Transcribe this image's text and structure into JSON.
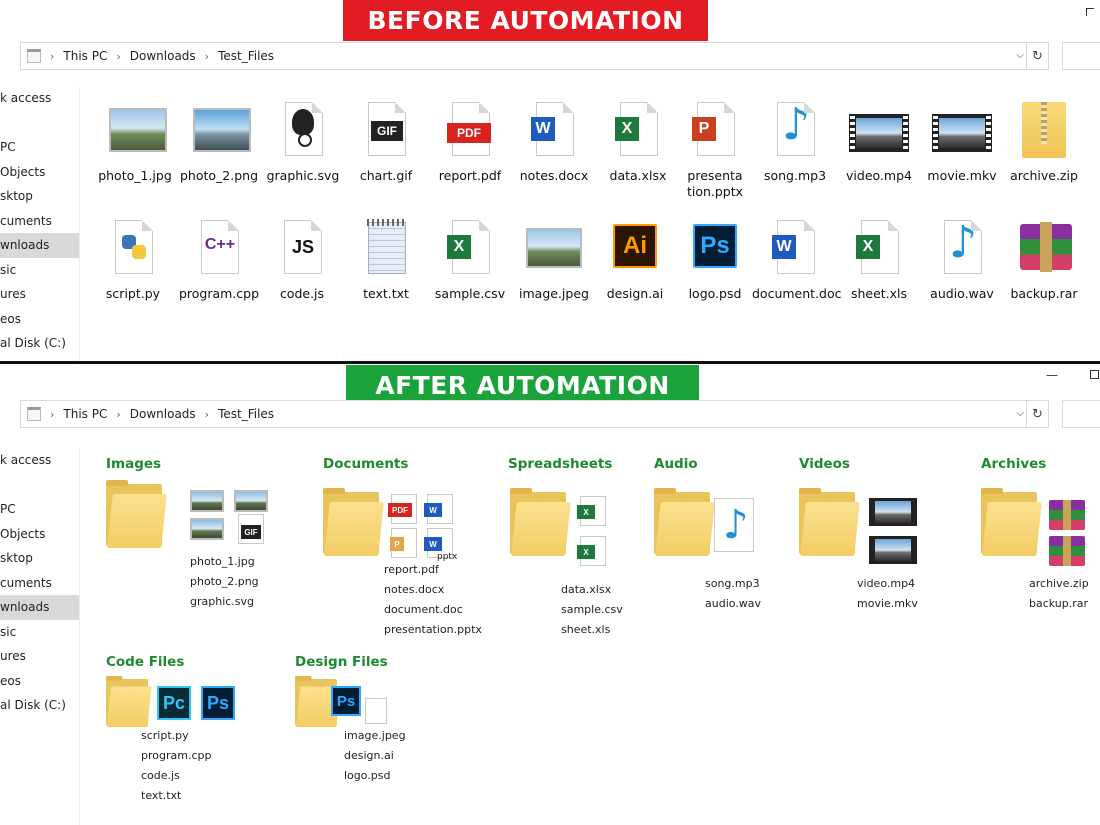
{
  "before": {
    "banner": "BEFORE AUTOMATION",
    "breadcrumb": [
      "This PC",
      "Downloads",
      "Test_Files"
    ],
    "nav": [
      "k access",
      "",
      "PC",
      "Objects",
      "sktop",
      "cuments",
      "wnloads",
      "sic",
      "ures",
      "eos",
      "al Disk (C:)"
    ],
    "files": [
      {
        "name": "photo_1.jpg",
        "icon": "image-icon"
      },
      {
        "name": "photo_2.png",
        "icon": "image-icon"
      },
      {
        "name": "graphic.svg",
        "icon": "inkscape-icon"
      },
      {
        "name": "chart.gif",
        "icon": "gif-icon"
      },
      {
        "name": "report.pdf",
        "icon": "pdf-icon"
      },
      {
        "name": "notes.docx",
        "icon": "word-icon"
      },
      {
        "name": "data.xlsx",
        "icon": "excel-icon"
      },
      {
        "name": "presentation.pptx",
        "icon": "powerpoint-icon"
      },
      {
        "name": "song.mp3",
        "icon": "audio-icon"
      },
      {
        "name": "video.mp4",
        "icon": "video-icon"
      },
      {
        "name": "movie.mkv",
        "icon": "video-icon"
      },
      {
        "name": "archive.zip",
        "icon": "zip-icon"
      },
      {
        "name": "script.py",
        "icon": "python-icon"
      },
      {
        "name": "program.cpp",
        "icon": "cpp-icon"
      },
      {
        "name": "code.js",
        "icon": "js-icon"
      },
      {
        "name": "text.txt",
        "icon": "notepad-icon"
      },
      {
        "name": "sample.csv",
        "icon": "excel-icon"
      },
      {
        "name": "image.jpeg",
        "icon": "image-icon"
      },
      {
        "name": "design.ai",
        "icon": "illustrator-icon"
      },
      {
        "name": "logo.psd",
        "icon": "photoshop-icon"
      },
      {
        "name": "document.doc",
        "icon": "word-icon"
      },
      {
        "name": "sheet.xls",
        "icon": "excel-icon"
      },
      {
        "name": "audio.wav",
        "icon": "audio-icon"
      },
      {
        "name": "backup.rar",
        "icon": "rar-icon"
      }
    ],
    "badges": {
      "gif": "GIF",
      "pdf": "PDF",
      "word": "W",
      "excel": "X",
      "ppt": "P",
      "cpp": "C++",
      "js": "JS",
      "ai": "Ai",
      "ps": "Ps"
    }
  },
  "after": {
    "banner": "AFTER AUTOMATION",
    "breadcrumb": [
      "This PC",
      "Downloads",
      "Test_Files"
    ],
    "nav": [
      "k access",
      "",
      "PC",
      "Objects",
      "sktop",
      "cuments",
      "wnloads",
      "sic",
      "ures",
      "eos",
      "al Disk (C:)"
    ],
    "groups": {
      "images": {
        "title": "Images",
        "files": [
          "photo_1.jpg",
          "photo_2.png",
          "graphic.svg"
        ]
      },
      "documents": {
        "title": "Documents",
        "files": [
          "report.pdf",
          "notes.docx",
          "document.doc",
          "presentation.pptx"
        ],
        "overlay": "pptx"
      },
      "spreadsheets": {
        "title": "Spreadsheets",
        "files": [
          "data.xlsx",
          "sample.csv",
          "sheet.xls"
        ]
      },
      "audio": {
        "title": "Audio",
        "files": [
          "song.mp3",
          "audio.wav"
        ]
      },
      "videos": {
        "title": "Videos",
        "files": [
          "video.mp4",
          "movie.mkv"
        ]
      },
      "archives": {
        "title": "Archives",
        "files": [
          "archive.zip",
          "backup.rar"
        ]
      },
      "code": {
        "title": "Code Files",
        "files": [
          "script.py",
          "program.cpp",
          "code.js",
          "text.txt"
        ]
      },
      "design": {
        "title": "Design Files",
        "files": [
          "image.jpeg",
          "design.ai",
          "logo.psd"
        ]
      }
    },
    "mini_badges": {
      "gif": "GIF",
      "pdf": "PDF",
      "word": "W",
      "excel": "X",
      "pc": "Pc",
      "ps": "Ps"
    }
  },
  "colors": {
    "before_banner": "#e31b23",
    "after_banner": "#1aa33a",
    "group_title": "#1e8a2f",
    "folder": "#f3cd64",
    "selected_nav": "#d9d9d9"
  }
}
